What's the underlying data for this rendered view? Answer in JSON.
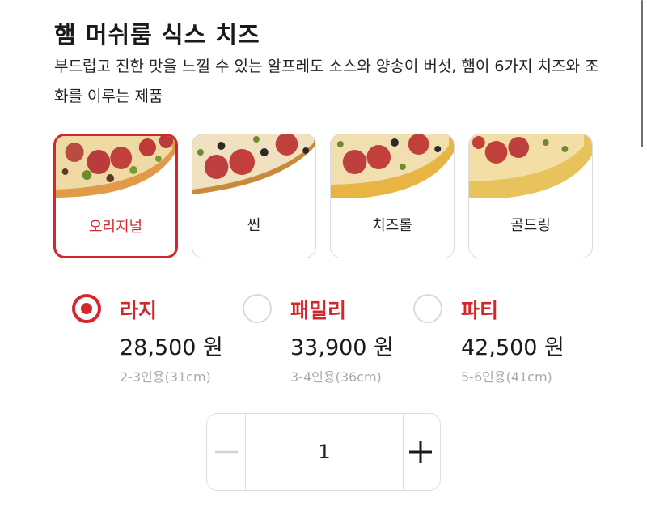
{
  "product": {
    "title": "햄 머쉬룸 식스 치즈",
    "description": "부드럽고 진한 맛을 느낄 수 있는 알프레도 소스와 양송이 버섯, 햄이 6가지 치즈와 조화를 이루는 제품"
  },
  "crusts": [
    {
      "label": "오리지널",
      "selected": true
    },
    {
      "label": "씬",
      "selected": false
    },
    {
      "label": "치즈롤",
      "selected": false
    },
    {
      "label": "골드링",
      "selected": false
    }
  ],
  "sizes": [
    {
      "name": "라지",
      "price": "28,500 원",
      "serving": "2-3인용(31cm)",
      "selected": true
    },
    {
      "name": "패밀리",
      "price": "33,900 원",
      "serving": "3-4인용(36cm)",
      "selected": false
    },
    {
      "name": "파티",
      "price": "42,500 원",
      "serving": "5-6인용(41cm)",
      "selected": false
    }
  ],
  "quantity": {
    "value": "1",
    "minus_icon": "minus-icon",
    "plus_icon": "plus-icon"
  },
  "colors": {
    "accent": "#d3272c",
    "border": "#dcdcdc",
    "muted": "#a9a9a9",
    "disabled": "#d2d2d2"
  }
}
